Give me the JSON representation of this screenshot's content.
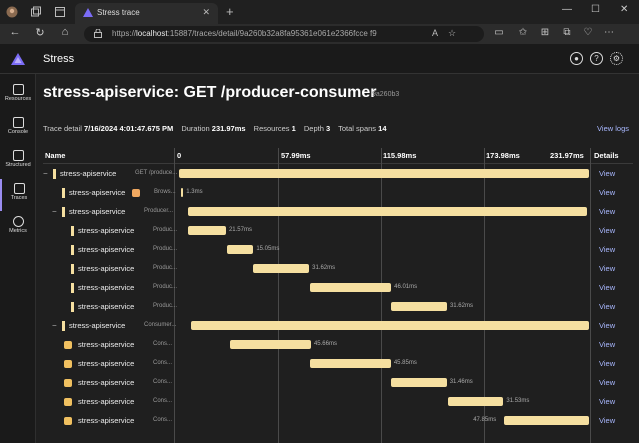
{
  "browser": {
    "tab_title": "Stress trace",
    "url_prefix": "https://",
    "url_host": "localhost",
    "url_rest": ":15887/traces/detail/9a260b32a8fa95361e061e2366fcce f9"
  },
  "app": {
    "name": "Stress",
    "sidebar": [
      {
        "label": "Resources"
      },
      {
        "label": "Console"
      },
      {
        "label": "Structured"
      },
      {
        "label": "Traces"
      },
      {
        "label": "Metrics"
      }
    ]
  },
  "page": {
    "title": "stress-apiservice: GET /producer-consumer",
    "trace_id": "9a260b3",
    "trace_detail_label": "Trace detail",
    "trace_detail_value": "7/16/2024 4:01:47.675 PM",
    "duration_label": "Duration",
    "duration_value": "231.97ms",
    "resources_label": "Resources",
    "resources_value": "1",
    "depth_label": "Depth",
    "depth_value": "3",
    "total_spans_label": "Total spans",
    "total_spans_value": "14",
    "view_logs": "View logs"
  },
  "grid": {
    "col_name": "Name",
    "col_details": "Details",
    "ticks": [
      "0",
      "57.99ms",
      "115.98ms",
      "173.98ms",
      "231.97ms"
    ],
    "view_label": "View",
    "total_ms": 231.97,
    "rows": [
      {
        "depth": 0,
        "toggle": "−",
        "kind": "server",
        "service": "stress-apiservice",
        "op": "GET /produce...",
        "start": 0,
        "dur": 231.97,
        "label": ""
      },
      {
        "depth": 1,
        "toggle": "",
        "kind": "client",
        "service": "stress-apiservice",
        "op": "Brows...",
        "start": 1.3,
        "dur": 0,
        "label": "1.3ms"
      },
      {
        "depth": 1,
        "toggle": "−",
        "kind": "internal",
        "service": "stress-apiservice",
        "op": "Producer...",
        "start": 5,
        "dur": 226,
        "label": ""
      },
      {
        "depth": 2,
        "toggle": "",
        "kind": "internal",
        "service": "stress-apiservice",
        "op": "Produc...",
        "start": 5,
        "dur": 21.57,
        "label": "21.57ms"
      },
      {
        "depth": 2,
        "toggle": "",
        "kind": "internal",
        "service": "stress-apiservice",
        "op": "Produc...",
        "start": 27,
        "dur": 15.05,
        "label": "15.05ms"
      },
      {
        "depth": 2,
        "toggle": "",
        "kind": "internal",
        "service": "stress-apiservice",
        "op": "Produc...",
        "start": 42,
        "dur": 31.62,
        "label": "31.62ms"
      },
      {
        "depth": 2,
        "toggle": "",
        "kind": "internal",
        "service": "stress-apiservice",
        "op": "Produc...",
        "start": 74,
        "dur": 46.01,
        "label": "46.01ms"
      },
      {
        "depth": 2,
        "toggle": "",
        "kind": "internal",
        "service": "stress-apiservice",
        "op": "Produc...",
        "start": 120,
        "dur": 31.62,
        "label": "31.62ms"
      },
      {
        "depth": 1,
        "toggle": "−",
        "kind": "internal",
        "service": "stress-apiservice",
        "op": "Consumer...",
        "start": 7,
        "dur": 225,
        "label": ""
      },
      {
        "depth": 2,
        "toggle": "",
        "kind": "consumer",
        "service": "stress-apiservice",
        "op": "Cons...",
        "start": 29,
        "dur": 45.66,
        "label": "45.66ms"
      },
      {
        "depth": 2,
        "toggle": "",
        "kind": "consumer",
        "service": "stress-apiservice",
        "op": "Cons...",
        "start": 74,
        "dur": 45.85,
        "label": "45.85ms"
      },
      {
        "depth": 2,
        "toggle": "",
        "kind": "consumer",
        "service": "stress-apiservice",
        "op": "Cons...",
        "start": 120,
        "dur": 31.46,
        "label": "31.46ms"
      },
      {
        "depth": 2,
        "toggle": "",
        "kind": "consumer",
        "service": "stress-apiservice",
        "op": "Cons...",
        "start": 152,
        "dur": 31.53,
        "label": "31.53ms"
      },
      {
        "depth": 2,
        "toggle": "",
        "kind": "consumer",
        "service": "stress-apiservice",
        "op": "Cons...",
        "start": 184,
        "dur": 47.85,
        "label": "47.85ms"
      }
    ]
  },
  "colors": {
    "bar": "#f5dfa0",
    "link": "#a9b8ff",
    "client_icon": "#f0a860",
    "consumer_icon": "#f0c060"
  }
}
